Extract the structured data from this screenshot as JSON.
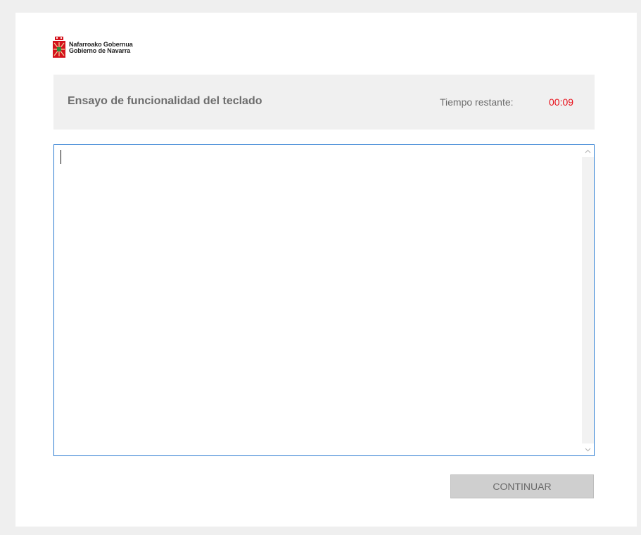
{
  "brand": {
    "line1": "Nafarroako Gobernua",
    "line2": "Gobierno de Navarra",
    "color": "#d4121c"
  },
  "header": {
    "title": "Ensayo de funcionalidad del teclado",
    "timer_label": "Tiempo restante:",
    "timer_value": "00:09",
    "timer_color": "#e8101a"
  },
  "editor": {
    "value": "",
    "border_color": "#2a7bd1"
  },
  "actions": {
    "continue_label": "CONTINUAR"
  },
  "icons": {
    "logo": "navarra-coat-of-arms-icon",
    "scroll_up": "chevron-up-icon",
    "scroll_down": "chevron-down-icon"
  }
}
